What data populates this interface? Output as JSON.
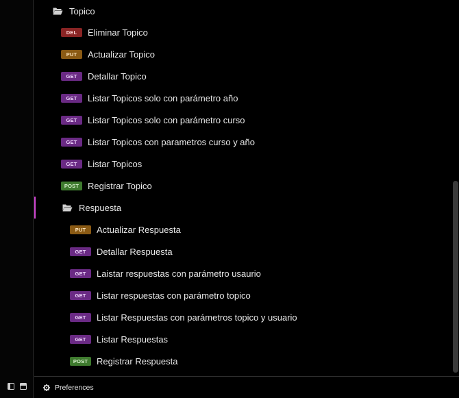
{
  "colors": {
    "accent": "#d449d6",
    "del": "#8a2424",
    "put": "#8a5a14",
    "get": "#6a2a84",
    "post": "#3e7a2e"
  },
  "tree": {
    "topico_folder": {
      "label": "Topico",
      "icon": "folder-open-icon"
    },
    "topico_requests": [
      {
        "method": "DEL",
        "label": "Eliminar Topico"
      },
      {
        "method": "PUT",
        "label": "Actualizar Topico"
      },
      {
        "method": "GET",
        "label": "Detallar Topico"
      },
      {
        "method": "GET",
        "label": "Listar Topicos solo con parámetro año"
      },
      {
        "method": "GET",
        "label": "Listar Topicos solo con parámetro curso"
      },
      {
        "method": "GET",
        "label": "Listar Topicos con parametros curso y año"
      },
      {
        "method": "GET",
        "label": "Listar Topicos"
      },
      {
        "method": "POST",
        "label": "Registrar Topico"
      }
    ],
    "respuesta_folder": {
      "label": "Respuesta",
      "icon": "folder-open-icon"
    },
    "respuesta_requests": [
      {
        "method": "PUT",
        "label": "Actualizar Respuesta"
      },
      {
        "method": "GET",
        "label": "Detallar Respuesta"
      },
      {
        "method": "GET",
        "label": "Laistar respuestas con parámetro usaurio"
      },
      {
        "method": "GET",
        "label": "Listar respuestas con parámetro topico"
      },
      {
        "method": "GET",
        "label": "Listar Respuestas con parámetros topico y usuario"
      },
      {
        "method": "GET",
        "label": "Listar Respuestas"
      },
      {
        "method": "POST",
        "label": "Registrar Respuesta"
      }
    ]
  },
  "footer": {
    "preferences_label": "Preferences",
    "preferences_icon": "gear-icon"
  },
  "rail": {
    "icons": [
      "sidebar-toggle-icon",
      "panel-layout-icon"
    ]
  }
}
